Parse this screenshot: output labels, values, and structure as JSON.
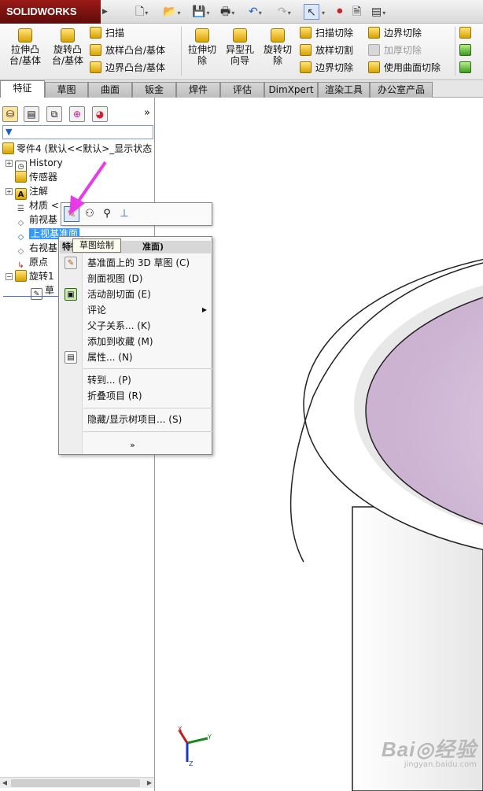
{
  "app": {
    "name": "SOLIDWORKS"
  },
  "colors": {
    "accent": "#3399ff",
    "brand": "#8a1410",
    "arrow": "#e83be8",
    "part_inner": "#d9c6dd"
  },
  "ribbon": {
    "big": [
      "拉伸凸\n台/基体",
      "旋转凸\n台/基体",
      "拉伸切\n除",
      "异型孔\n向导",
      "旋转切\n除"
    ],
    "small": [
      "扫描",
      "放样凸台/基体",
      "边界凸台/基体",
      "扫描切除",
      "放样切割",
      "边界切除",
      "边界切除",
      "加厚切除",
      "使用曲面切除"
    ]
  },
  "tabs": [
    "特征",
    "草图",
    "曲面",
    "钣金",
    "焊件",
    "评估",
    "DimXpert",
    "渲染工具",
    "办公室产品"
  ],
  "tree": {
    "root": "零件4 (默认<<默认>_显示状态",
    "items": [
      "History",
      "传感器",
      "注解",
      "材质 <",
      "前视基",
      "上视基准面",
      "右视基",
      "原点",
      "旋转1",
      "草"
    ]
  },
  "context_toolbar": {
    "tooltip": "草图绘制"
  },
  "context_menu": {
    "header": "特征",
    "header_tail": "准面)",
    "items": [
      {
        "label": "基准面上的 3D 草图 (C)"
      },
      {
        "label": "剖面视图 (D)"
      },
      {
        "label": "活动剖切面 (E)"
      },
      {
        "label": "评论"
      },
      {
        "label": "父子关系... (K)"
      },
      {
        "label": "添加到收藏 (M)"
      },
      {
        "label": "属性... (N)"
      },
      {
        "label": "转到... (P)"
      },
      {
        "label": "折叠项目 (R)"
      },
      {
        "label": "隐藏/显示树项目... (S)"
      }
    ],
    "more": "»"
  },
  "triad": {
    "x": "X",
    "y": "Y",
    "z": "Z"
  },
  "watermark": {
    "main": "Bai◎经验",
    "sub": "jingyan.baidu.com"
  }
}
